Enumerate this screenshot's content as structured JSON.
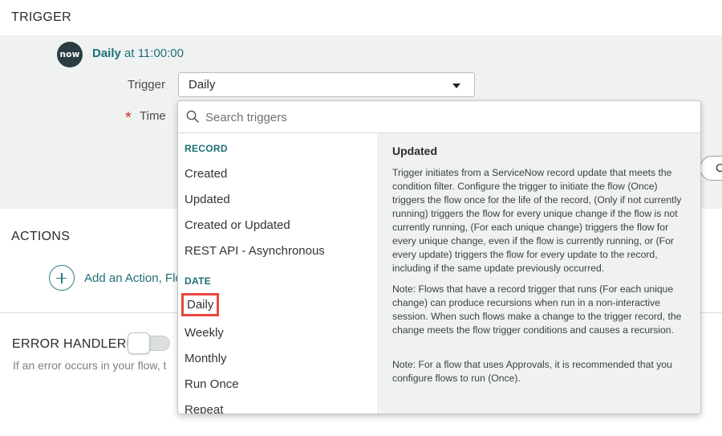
{
  "trigger_section": {
    "title": "TRIGGER",
    "summary_bold": "Daily",
    "summary_rest": " at 11:00:00",
    "logo_text": "now",
    "trigger_label": "Trigger",
    "trigger_value": "Daily",
    "required_marker": "*",
    "time_label": "Time",
    "partial_button_label": "C"
  },
  "actions_section": {
    "title": "ACTIONS",
    "add_action_text": "Add an Action, Flo"
  },
  "error_section": {
    "title": "ERROR HANDLER",
    "description": "If an error occurs in your flow, t",
    "toggle_on": false
  },
  "dropdown": {
    "search_placeholder": "Search triggers",
    "groups": [
      {
        "label": "RECORD",
        "items": [
          "Created",
          "Updated",
          "Created or Updated",
          "REST API - Asynchronous"
        ]
      },
      {
        "label": "DATE",
        "items": [
          "Daily",
          "Weekly",
          "Monthly",
          "Run Once",
          "Repeat"
        ]
      }
    ],
    "selected_item": "Daily",
    "description": {
      "title": "Updated",
      "paragraphs": [
        "Trigger initiates from a ServiceNow record update that meets the condition filter. Configure the trigger to initiate the flow (Once) triggers the flow once for the life of the record, (Only if not currently running) triggers the flow for every unique change if the flow is not currently running, (For each unique change) triggers the flow for every unique change, even if the flow is currently running, or (For every update) triggers the flow for every update to the record, including if the same update previously occurred.",
        "Note: Flows that have a record trigger that runs (For each unique change) can produce recursions when run in a non-interactive session. When such flows make a change to the trigger record, the change meets the flow trigger conditions and causes a recursion.",
        "Note: For a flow that uses Approvals, it is recommended that you configure flows to run (Once)."
      ]
    }
  },
  "colors": {
    "accent_teal": "#1e6f76",
    "highlight_red": "#e8473f",
    "required_red": "#d0342c",
    "panel_gray": "#f0f2f2"
  },
  "icons": {
    "search": "search-icon",
    "caret": "chevron-down-icon",
    "add": "plus-circle-icon"
  }
}
